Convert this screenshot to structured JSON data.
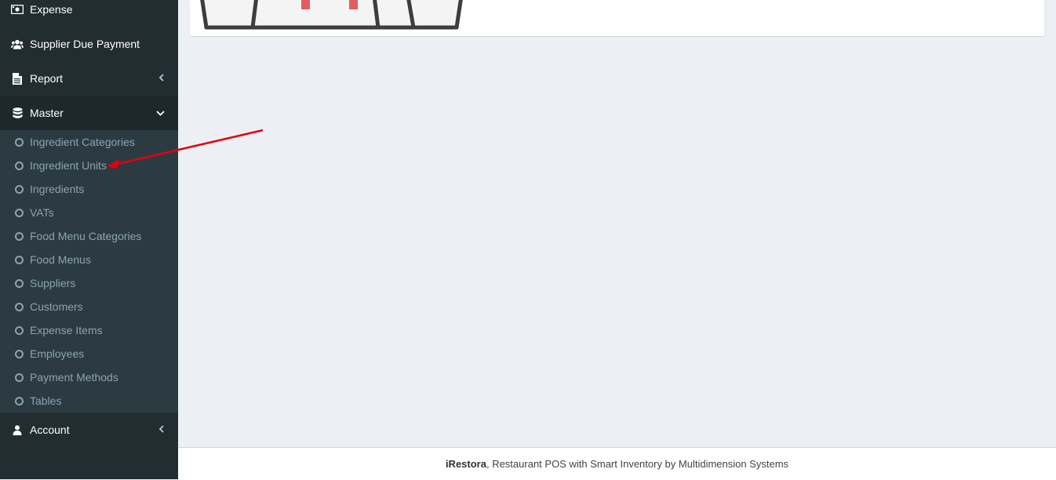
{
  "sidebar": {
    "items": [
      {
        "label": "Expense",
        "icon": "money-icon"
      },
      {
        "label": "Supplier Due Payment",
        "icon": "users-icon"
      },
      {
        "label": "Report",
        "icon": "file-text-icon"
      },
      {
        "label": "Master",
        "icon": "database-icon"
      }
    ],
    "master_submenu": [
      "Ingredient Categories",
      "Ingredient Units",
      "Ingredients",
      "VATs",
      "Food Menu Categories",
      "Food Menus",
      "Suppliers",
      "Customers",
      "Expense Items",
      "Employees",
      "Payment Methods",
      "Tables"
    ],
    "account": {
      "label": "Account",
      "icon": "user-icon"
    }
  },
  "footer": {
    "brand": "iRestora",
    "text": ", Restaurant POS with Smart Inventory by Multidimension Systems"
  },
  "colors": {
    "sidebar_bg": "#222d32",
    "submenu_bg": "#2c3b41",
    "content_bg": "#ecf0f5",
    "annotation_arrow": "#e3000f"
  }
}
